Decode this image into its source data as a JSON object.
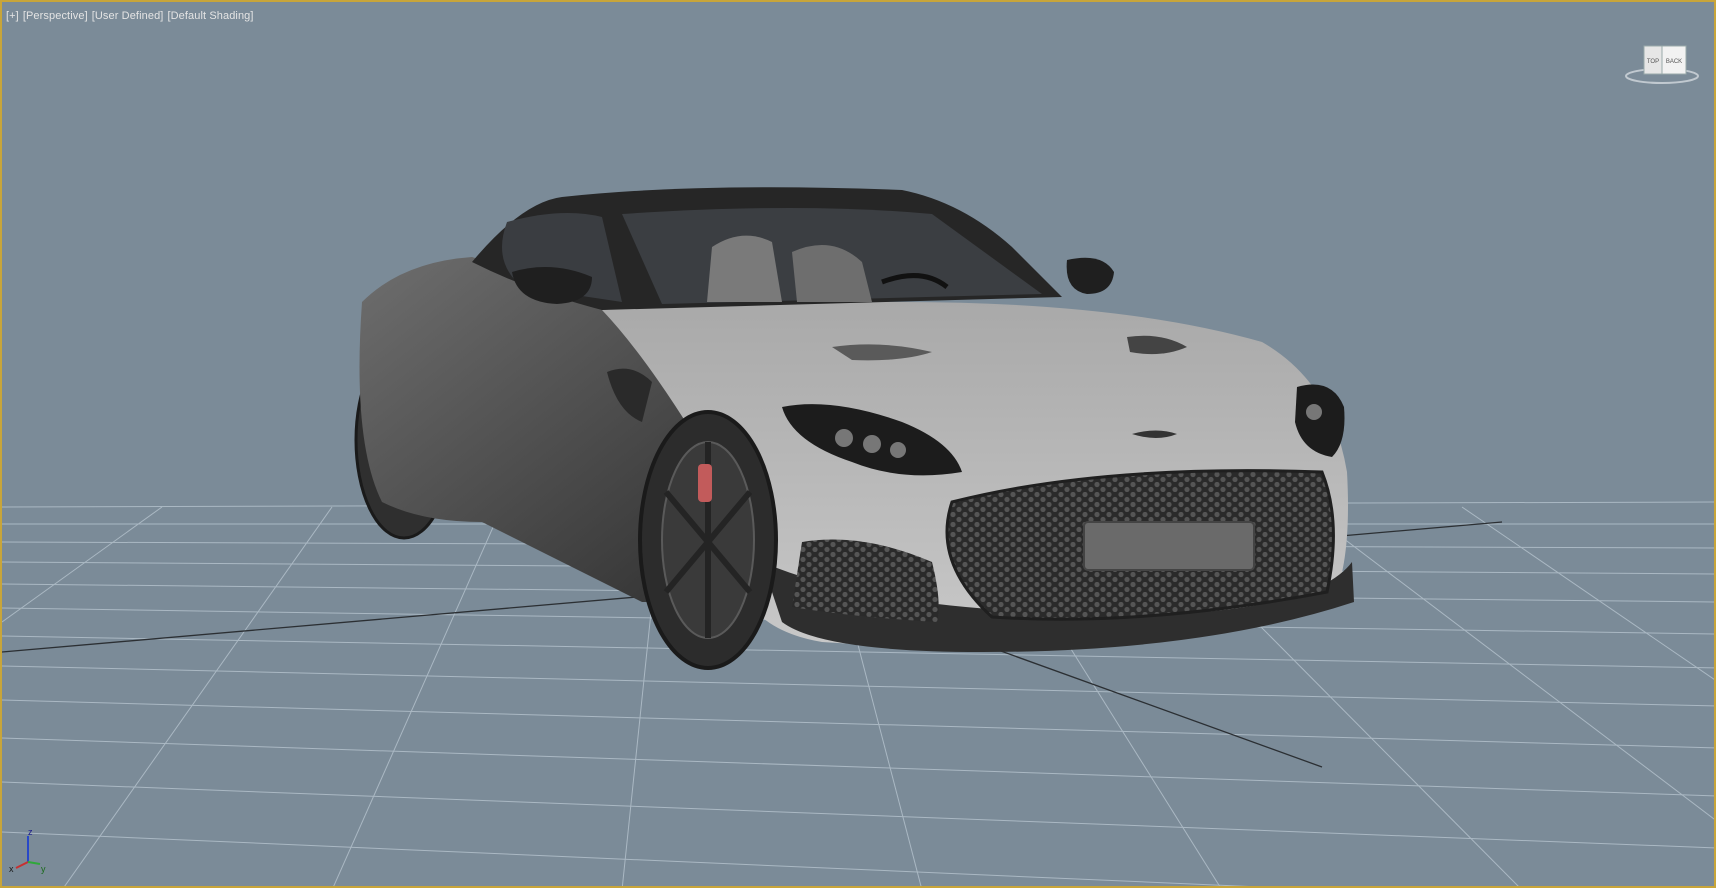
{
  "viewport": {
    "labels": {
      "menu": "[+]",
      "view": "[Perspective]",
      "shading_mode": "[User Defined]",
      "shading": "[Default Shading]"
    },
    "viewcube": {
      "face_top": "TOP",
      "face_back": "BACK"
    },
    "axis_gizmo": {
      "z": "z",
      "x": "x",
      "y": "y"
    },
    "colors": {
      "background": "#7b8b98",
      "grid_line": "#aab8c3",
      "grid_main": "#2b2f33",
      "border_active": "#c8a53a",
      "car_body": "#8a8a8a",
      "caliper": "#c25b5b"
    }
  }
}
